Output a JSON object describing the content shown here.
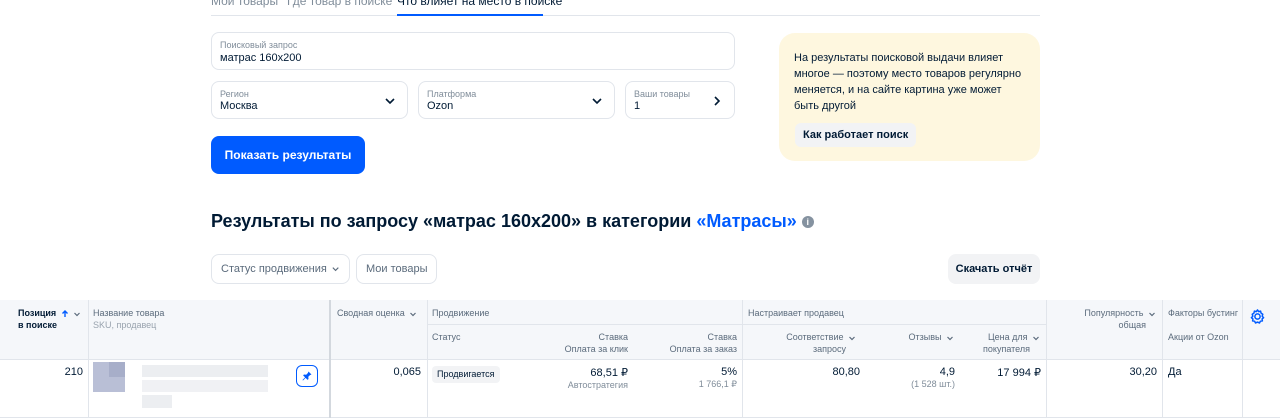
{
  "tabs": [
    {
      "label": "Мои товары",
      "active": false
    },
    {
      "label": "Где товар в поиске",
      "active": false
    },
    {
      "label": "Что влияет на место в поиске",
      "active": true
    }
  ],
  "form": {
    "query": {
      "label": "Поисковый запрос",
      "value": "матрас 160x200"
    },
    "region": {
      "label": "Регион",
      "value": "Москва"
    },
    "platform": {
      "label": "Платформа",
      "value": "Ozon"
    },
    "products": {
      "label": "Ваши товары",
      "value": "1"
    },
    "submit_label": "Показать результаты"
  },
  "info": {
    "text": "На результаты поисковой выдачи влияет многое — поэтому место товаров регулярно меняется, и на сайте картина уже может быть другой",
    "button_label": "Как работает поиск"
  },
  "results": {
    "heading_prefix": "Результаты по запросу «матрас 160x200» в категории",
    "category": "«Матрасы»",
    "info_icon": "i"
  },
  "filters": {
    "promotion_status": "Статус продвижения",
    "my_products": "Мои товары",
    "download_label": "Скачать отчёт"
  },
  "table": {
    "headers": {
      "position": "Позиция",
      "position_sub": "в поиске",
      "product_name": "Название товара",
      "product_sub": "SKU, продавец",
      "score": "Сводная оценка",
      "promotion": "Продвижение",
      "status": "Статус",
      "bid_click": "Ставка",
      "bid_click_sub": "Оплата за клик",
      "bid_order": "Ставка",
      "bid_order_sub": "Оплата за заказ",
      "seller_group": "Настраивает продавец",
      "relevance": "Соответствие",
      "relevance_sub": "запросу",
      "reviews": "Отзывы",
      "price": "Цена для",
      "price_sub": "покупателя",
      "popularity": "Популярность",
      "popularity_sub": "общая",
      "boost": "Факторы бустинг",
      "ozon_promos": "Акции от Ozon"
    },
    "row": {
      "position": "210",
      "score": "0,065",
      "status": "Продвигается",
      "bid_click": "68,51 ₽",
      "bid_click_sub": "Автостратегия",
      "bid_order": "5%",
      "bid_order_sub": "1 766,1 ₽",
      "relevance": "80,80",
      "reviews": "4,9",
      "reviews_sub": "(1 528 шт.)",
      "price": "17 994 ₽",
      "popularity": "30,20",
      "ozon_promos": "Да"
    }
  },
  "colors": {
    "accent": "#005bff",
    "info_bg": "#fef7df",
    "text": "#001a34",
    "muted": "#808d9a"
  }
}
